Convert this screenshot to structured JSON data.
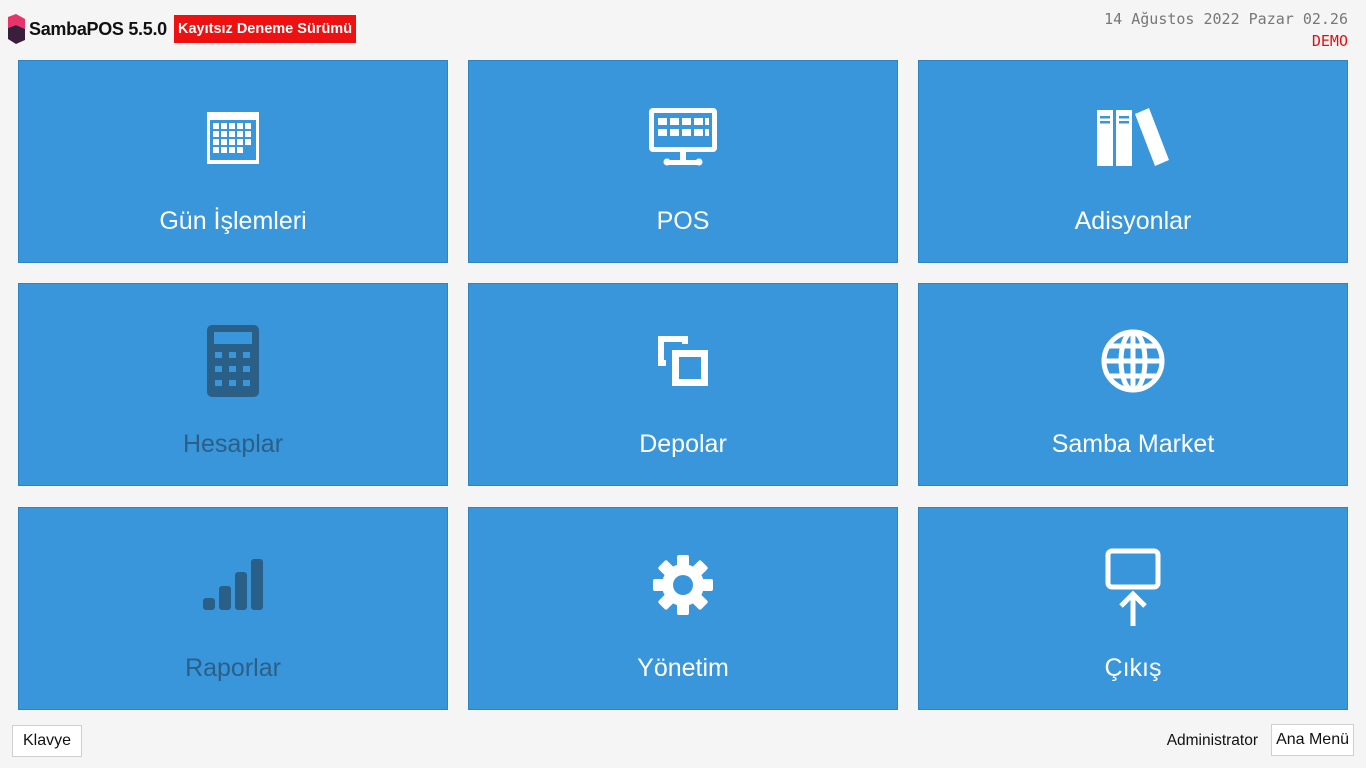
{
  "header": {
    "app_title": "SambaPOS 5.5.0",
    "trial_badge": "Kayıtsız Deneme Sürümü",
    "datetime": "14 Ağustos 2022 Pazar 02.26",
    "mode": "DEMO"
  },
  "tiles": [
    {
      "label": "Gün İşlemleri",
      "icon": "calendar-icon",
      "enabled": true
    },
    {
      "label": "POS",
      "icon": "pos-terminal-icon",
      "enabled": true
    },
    {
      "label": "Adisyonlar",
      "icon": "books-icon",
      "enabled": true
    },
    {
      "label": "Hesaplar",
      "icon": "calculator-icon",
      "enabled": false
    },
    {
      "label": "Depolar",
      "icon": "copy-icon",
      "enabled": true
    },
    {
      "label": "Samba Market",
      "icon": "globe-icon",
      "enabled": true
    },
    {
      "label": "Raporlar",
      "icon": "signal-bars-icon",
      "enabled": false
    },
    {
      "label": "Yönetim",
      "icon": "gear-icon",
      "enabled": true
    },
    {
      "label": "Çıkış",
      "icon": "logout-icon",
      "enabled": true
    }
  ],
  "footer": {
    "keyboard_label": "Klavye",
    "user": "Administrator",
    "main_menu_label": "Ana Menü"
  },
  "colors": {
    "tile": "#3996db",
    "tile_disabled_text": "#2a5f88",
    "badge": "#ee1111",
    "demo": "#e01010"
  }
}
